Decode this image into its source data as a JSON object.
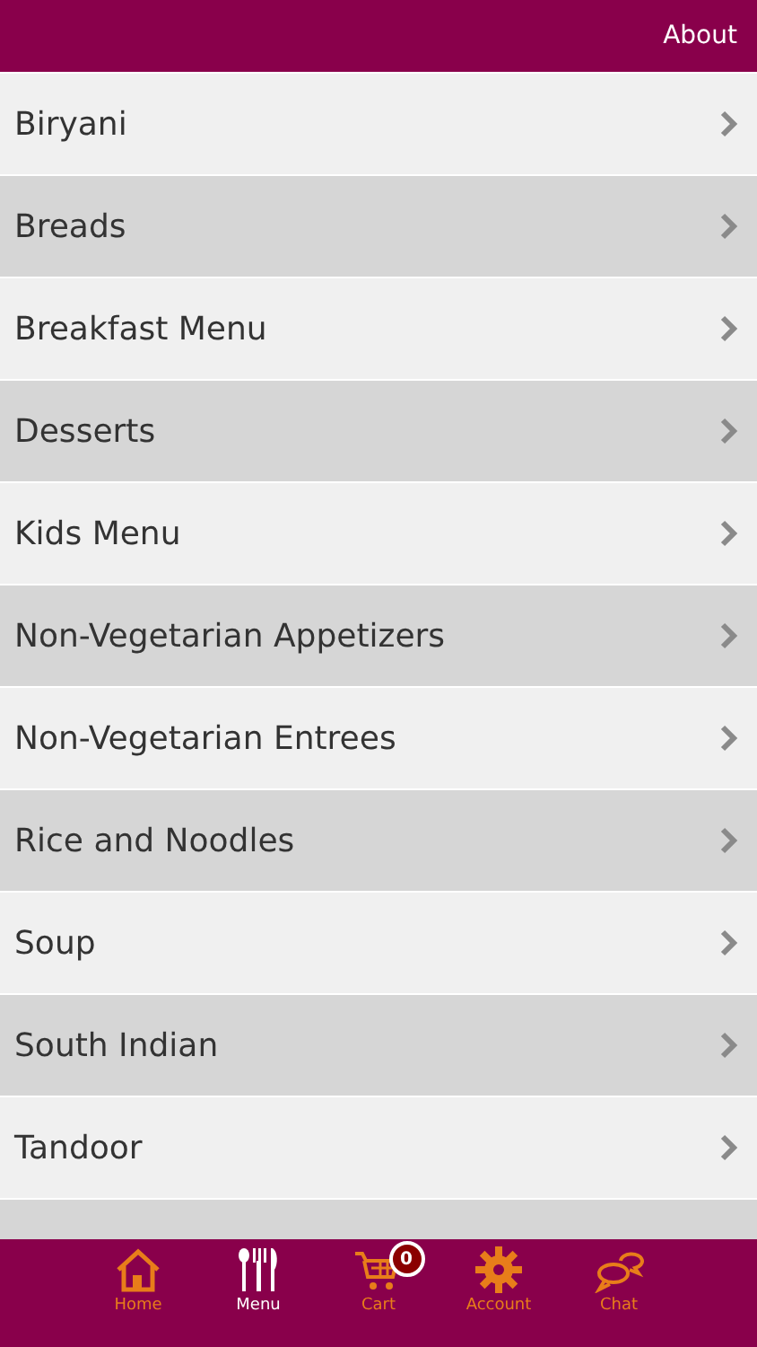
{
  "header": {
    "about_link": "About"
  },
  "categories": [
    {
      "label": "Biryani"
    },
    {
      "label": "Breads"
    },
    {
      "label": "Breakfast Menu"
    },
    {
      "label": "Desserts"
    },
    {
      "label": "Kids Menu"
    },
    {
      "label": "Non-Vegetarian Appetizers"
    },
    {
      "label": "Non-Vegetarian Entrees"
    },
    {
      "label": "Rice and Noodles"
    },
    {
      "label": "Soup"
    },
    {
      "label": "South Indian"
    },
    {
      "label": "Tandoor"
    }
  ],
  "tab_bar": [
    {
      "kind": "home",
      "label": "Home",
      "selected": false
    },
    {
      "kind": "menu",
      "label": "Menu",
      "selected": true
    },
    {
      "kind": "cart",
      "label": "Cart",
      "selected": false,
      "badge": "0"
    },
    {
      "kind": "account",
      "label": "Account",
      "selected": false
    },
    {
      "kind": "chat",
      "label": "Chat",
      "selected": false
    }
  ]
}
